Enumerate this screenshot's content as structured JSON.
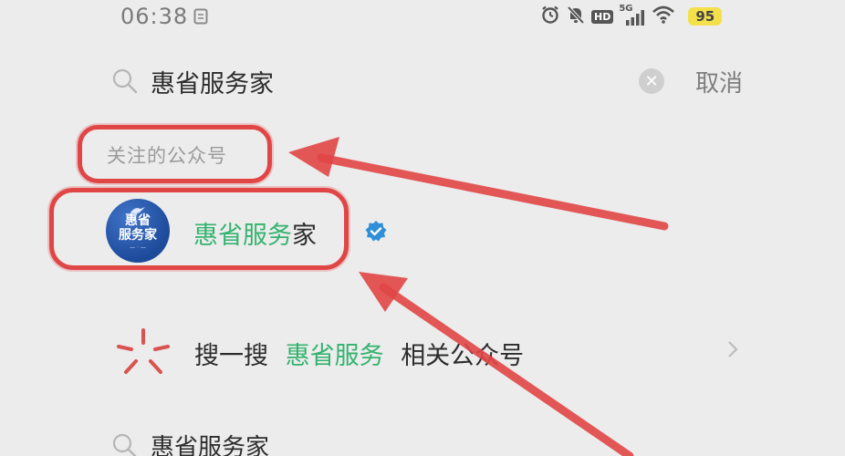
{
  "status_bar": {
    "time": "06:38",
    "network": "5G",
    "hd": "HD",
    "battery": "95"
  },
  "search": {
    "query": "惠省服务家",
    "cancel_label": "取消"
  },
  "section": {
    "label": "关注的公众号"
  },
  "result": {
    "name_highlight": "惠省服务",
    "name_rest": "家",
    "avatar_line1": "惠省",
    "avatar_line2": "服务家"
  },
  "sousou": {
    "prefix": "搜一搜",
    "keyword": "惠省服务",
    "suffix": "相关公众号"
  },
  "history": {
    "query": "惠省服务家"
  },
  "colors": {
    "highlight_green": "#34b36f",
    "annotation_red": "#e14646",
    "verified_blue": "#2f8fd8"
  }
}
